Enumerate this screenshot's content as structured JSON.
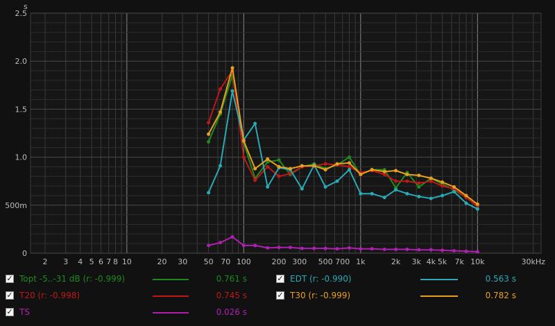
{
  "chart_data": {
    "type": "line",
    "x_scale": "log",
    "y_unit": "s",
    "xlim": [
      1.5,
      35000
    ],
    "ylim": [
      0,
      2.5
    ],
    "grid": true,
    "x_ticks": [
      {
        "v": 2,
        "label": "2"
      },
      {
        "v": 3,
        "label": "3"
      },
      {
        "v": 4,
        "label": "4"
      },
      {
        "v": 5,
        "label": "5"
      },
      {
        "v": 6,
        "label": "6"
      },
      {
        "v": 7,
        "label": "7"
      },
      {
        "v": 8,
        "label": "8"
      },
      {
        "v": 10,
        "label": "10"
      },
      {
        "v": 20,
        "label": "20"
      },
      {
        "v": 30,
        "label": "30"
      },
      {
        "v": 50,
        "label": "50"
      },
      {
        "v": 70,
        "label": "70"
      },
      {
        "v": 100,
        "label": "100"
      },
      {
        "v": 200,
        "label": "200"
      },
      {
        "v": 300,
        "label": "300"
      },
      {
        "v": 500,
        "label": "500"
      },
      {
        "v": 700,
        "label": "700"
      },
      {
        "v": 1000,
        "label": "1k"
      },
      {
        "v": 2000,
        "label": "2k"
      },
      {
        "v": 3000,
        "label": "3k"
      },
      {
        "v": 4000,
        "label": "4k"
      },
      {
        "v": 5000,
        "label": "5k"
      },
      {
        "v": 7000,
        "label": "7k"
      },
      {
        "v": 10000,
        "label": "10k"
      },
      {
        "v": 30000,
        "label": "30kHz"
      }
    ],
    "y_ticks": [
      {
        "v": 0,
        "label": "0"
      },
      {
        "v": 0.5,
        "label": "500m"
      },
      {
        "v": 1.0,
        "label": "1.0"
      },
      {
        "v": 1.5,
        "label": "1.5"
      },
      {
        "v": 2.0,
        "label": "2.0"
      },
      {
        "v": 2.5,
        "label": "2.5"
      }
    ],
    "x": [
      50,
      63,
      80,
      100,
      125,
      160,
      200,
      250,
      315,
      400,
      500,
      630,
      800,
      1000,
      1250,
      1600,
      2000,
      2500,
      3150,
      4000,
      5000,
      6300,
      8000,
      10000
    ],
    "series": [
      {
        "name": "Topt -5..-31 dB (r: -0.999)",
        "color": "#1f8a1f",
        "values": [
          1.16,
          1.45,
          1.85,
          1.15,
          0.78,
          0.95,
          0.97,
          0.82,
          0.9,
          0.93,
          0.88,
          0.92,
          1.0,
          0.82,
          0.87,
          0.87,
          0.68,
          0.84,
          0.69,
          0.78,
          0.72,
          0.66,
          0.58,
          0.49
        ],
        "total": "0.761 s"
      },
      {
        "name": "T20 (r: -0.998)",
        "color": "#c01818",
        "values": [
          1.36,
          1.71,
          1.9,
          1.0,
          0.76,
          0.9,
          0.8,
          0.83,
          0.9,
          0.91,
          0.93,
          0.92,
          0.9,
          0.84,
          0.86,
          0.82,
          0.75,
          0.75,
          0.73,
          0.75,
          0.7,
          0.67,
          0.58,
          0.49
        ],
        "total": "0.745 s"
      },
      {
        "name": "TS",
        "color": "#b020b0",
        "values": [
          0.08,
          0.11,
          0.17,
          0.08,
          0.08,
          0.055,
          0.06,
          0.06,
          0.05,
          0.05,
          0.05,
          0.045,
          0.055,
          0.045,
          0.045,
          0.04,
          0.04,
          0.04,
          0.035,
          0.035,
          0.03,
          0.025,
          0.02,
          0.015
        ],
        "total": "0.026 s"
      },
      {
        "name": "EDT (r: -0.990)",
        "color": "#2aaab5",
        "values": [
          0.63,
          0.91,
          1.69,
          1.18,
          1.35,
          0.69,
          0.89,
          0.87,
          0.67,
          0.92,
          0.69,
          0.75,
          0.87,
          0.62,
          0.62,
          0.58,
          0.66,
          0.62,
          0.59,
          0.57,
          0.6,
          0.64,
          0.52,
          0.46
        ],
        "total": "0.563 s"
      },
      {
        "name": "T30 (r: -0.999)",
        "color": "#e8a020",
        "values": [
          1.24,
          1.47,
          1.93,
          1.17,
          0.88,
          0.98,
          0.9,
          0.88,
          0.91,
          0.91,
          0.87,
          0.93,
          0.94,
          0.82,
          0.87,
          0.85,
          0.86,
          0.82,
          0.81,
          0.78,
          0.74,
          0.69,
          0.6,
          0.51
        ],
        "total": "0.782 s"
      }
    ]
  }
}
